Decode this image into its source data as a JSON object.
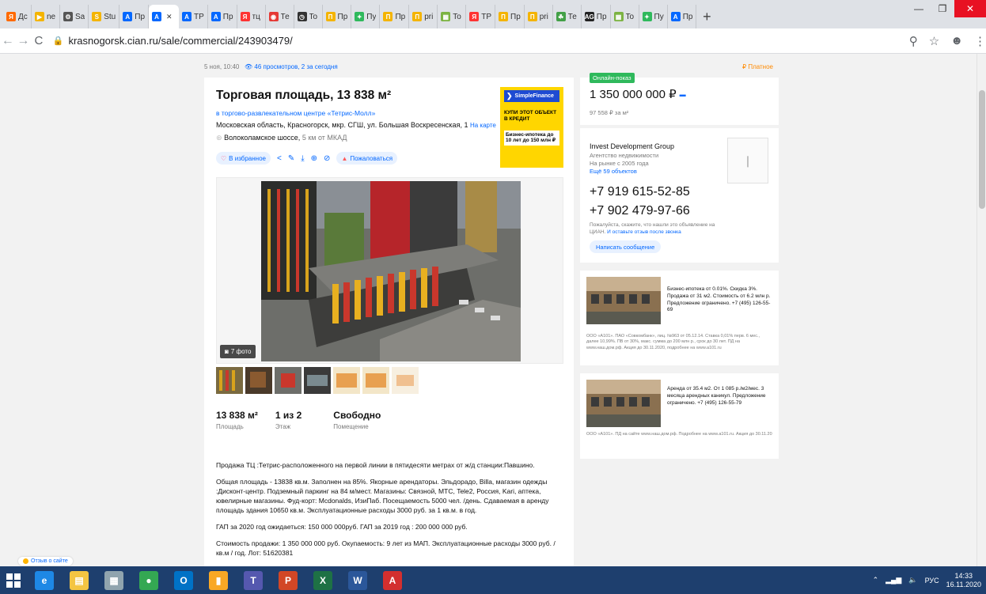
{
  "browser": {
    "tabs": [
      {
        "title": "Дс",
        "color": "#ff6a00",
        "glyph": "Я"
      },
      {
        "title": "ne",
        "color": "#f4b400",
        "glyph": "▶"
      },
      {
        "title": "Sa",
        "color": "#555555",
        "glyph": "⚙"
      },
      {
        "title": "Stu",
        "color": "#f4b400",
        "glyph": "S"
      },
      {
        "title": "Пр",
        "color": "#0468ff",
        "glyph": "A"
      },
      {
        "title": "",
        "color": "#0468ff",
        "glyph": "A",
        "active": true
      },
      {
        "title": "TP",
        "color": "#0468ff",
        "glyph": "A"
      },
      {
        "title": "Пр",
        "color": "#0468ff",
        "glyph": "A"
      },
      {
        "title": "тц",
        "color": "#ff3333",
        "glyph": "Я"
      },
      {
        "title": "Те",
        "color": "#e53935",
        "glyph": "◉"
      },
      {
        "title": "To",
        "color": "#333333",
        "glyph": "◷"
      },
      {
        "title": "Пр",
        "color": "#f4b400",
        "glyph": "П"
      },
      {
        "title": "Пу",
        "color": "#2fb95c",
        "glyph": "✦"
      },
      {
        "title": "Пр",
        "color": "#f4b400",
        "glyph": "П"
      },
      {
        "title": "pri",
        "color": "#f4b400",
        "glyph": "П"
      },
      {
        "title": "To",
        "color": "#7cb342",
        "glyph": "▦"
      },
      {
        "title": "TP",
        "color": "#ff3333",
        "glyph": "Я"
      },
      {
        "title": "Пр",
        "color": "#f4b400",
        "glyph": "П"
      },
      {
        "title": "pri",
        "color": "#f4b400",
        "glyph": "П"
      },
      {
        "title": "Те",
        "color": "#43a047",
        "glyph": "☘"
      },
      {
        "title": "Пр",
        "color": "#222222",
        "glyph": "AG"
      },
      {
        "title": "To",
        "color": "#7cb342",
        "glyph": "▦"
      },
      {
        "title": "Пу",
        "color": "#2fb95c",
        "glyph": "✦"
      },
      {
        "title": "Пр",
        "color": "#0468ff",
        "glyph": "A"
      }
    ],
    "url": "krasnogorsk.cian.ru/sale/commercial/243903479/"
  },
  "listing": {
    "date": "5 ноя, 10:40",
    "views": "46 просмотров, 2 за сегодня",
    "complaint": "Платное",
    "title": "Торговая площадь, 13 838 м²",
    "mall_link": "в торгово-развлекательном центре «Тетрис-Молл»",
    "address": "Московская область, Красногорск, мкр. СГШ, ул. Большая Воскресенская, 1",
    "map_link": "На карте",
    "highway": "Волоколамское шоссе,",
    "highway_distance": "5 км от МКАД",
    "favorite": "В избранное",
    "report": "Пожаловаться",
    "photo_count": "7 фото",
    "facts": [
      {
        "value": "13 838 м²",
        "label": "Площадь"
      },
      {
        "value": "1 из 2",
        "label": "Этаж"
      },
      {
        "value": "Свободно",
        "label": "Помещение"
      }
    ],
    "description": [
      "Продажа ТЦ :Тетрис-расположенного на первой линии в пятидесяти метрах от ж/д станции:Павшино.",
      "Общая площадь - 13838 кв.м. Заполнен на 85%. Якорные арендаторы. Эльдорадо, Billa, магазин одежды :Дисконт-центр. Подземный паркинг на 84 м/мест. Магазины: Связной, МТС, Tele2, Россия, Kari, аптека, ювелирные магазины. Фуд-корт: Mcdonalds, ИзиПаб. Посещаемость 5000 чел. /день. Сдаваемая в аренду площадь здания 10650 кв.м. Эксплуатационные расходы 3000 руб. за 1 кв.м. в год.",
      "ГАП за 2020 год ожидаеться: 150 000 000руб. ГАП за 2019 год : 200 000 000 руб.",
      "Стоимость продажи: 1 350 000 000 руб. Окупаемость: 9 лет из МАП. Эксплуатационные расходы 3000 руб. / кв.м / год. Лот: 51620381"
    ]
  },
  "ad_banner": {
    "brand": "SimpleFinance",
    "line1": "КУПИ ЭТОТ ОБЪЕКТ В КРЕДИТ",
    "line2": "Бизнес-ипотека до 10 лет до 150 млн ₽"
  },
  "price": {
    "badge": "Онлайн-показ",
    "value": "1 350 000 000 ₽",
    "per_m2": "97 558 ₽ за м²"
  },
  "agent": {
    "name": "Invest Development Group",
    "type": "Агентство недвижимости",
    "since": "На рынке с 2005 года",
    "more": "Ещё 59 объектов",
    "phone1": "+7 919 615-52-85",
    "phone2": "+7 902 479-97-66",
    "note": "Пожалуйста, скажите, что нашли это объявление на ЦИАН.",
    "note_link": "И оставьте отзыв после звонка",
    "message_btn": "Написать сообщение"
  },
  "ads": [
    {
      "text": "Бизнес-ипотека от 0.01%. Скидка 3%. Продажа от 31 м2. Стоимость от 6.2 млн р. Предложение ограничено. +7 (495) 126-55-69",
      "fine": "ООО «А101». ПАО «Совкомбанк», лиц. №963 от 05.12.14. Ставка 0,01% перв. 6 мес., далее 10,99%. ПВ от 30%, макс. сумма до 200 млн р., срок до 30 лет. ПД на www.наш.дом.рф. Акция до 30.11.2020, подробнее на www.a101.ru"
    },
    {
      "text": "Аренда от 35.4 м2. От 1 085 р./м2/мес. 3 месяца арендных каникул. Предложение ограничено. +7 (495) 126-55-79",
      "fine": "ООО «А101». ПД на сайте www.наш.дом.рф. Подробнее на www.a101.ru. Акция до 30.11.20"
    }
  ],
  "feedback": "Отзыв о сайте",
  "taskbar": {
    "lang": "РУС",
    "time": "14:33",
    "date": "16.11.2020",
    "apps": [
      {
        "name": "ie-icon",
        "color": "#1e88e5",
        "glyph": "e"
      },
      {
        "name": "explorer-icon",
        "color": "#f4c542",
        "glyph": "▤"
      },
      {
        "name": "calculator-icon",
        "color": "#90a4ae",
        "glyph": "▦"
      },
      {
        "name": "chrome-icon",
        "color": "#34a853",
        "glyph": "●"
      },
      {
        "name": "outlook-icon",
        "color": "#0072c6",
        "glyph": "O"
      },
      {
        "name": "charts-icon",
        "color": "#f9a825",
        "glyph": "▮"
      },
      {
        "name": "teams-icon",
        "color": "#5558af",
        "glyph": "T"
      },
      {
        "name": "powerpoint-icon",
        "color": "#d24726",
        "glyph": "P"
      },
      {
        "name": "excel-icon",
        "color": "#1e7145",
        "glyph": "X"
      },
      {
        "name": "word-icon",
        "color": "#2b579a",
        "glyph": "W"
      },
      {
        "name": "acrobat-icon",
        "color": "#d32f2f",
        "glyph": "A"
      }
    ]
  }
}
